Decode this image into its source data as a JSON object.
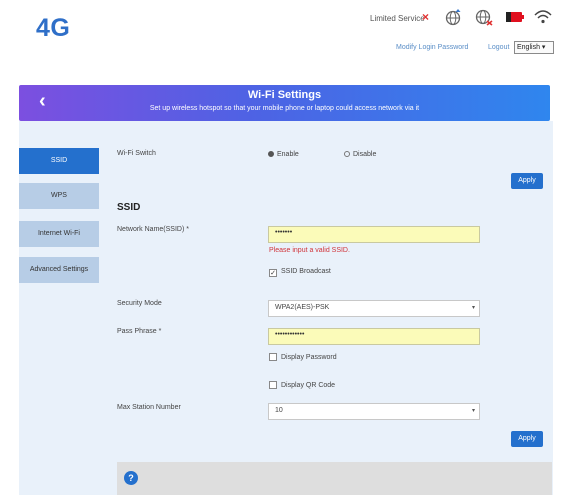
{
  "header": {
    "logo": "4G",
    "status_text": "Limited Service",
    "status_mark": "×",
    "links": {
      "modify_password": "Modify Login Password",
      "logout": "Logout"
    },
    "language": "English ▾",
    "icons": [
      "globe-icon",
      "no-signal-icon",
      "battery-icon",
      "wifi-icon"
    ],
    "colors": {
      "logo": "#2f6fc8",
      "battery": "#e0101f"
    }
  },
  "banner": {
    "back": "‹",
    "title": "Wi-Fi Settings",
    "subtitle": "Set up wireless hotspot so that your mobile phone or laptop could access network via it"
  },
  "sidebar": {
    "items": [
      {
        "label": "SSID"
      },
      {
        "label": "WPS"
      },
      {
        "label": "Internet Wi-Fi"
      },
      {
        "label": "Advanced Settings"
      }
    ]
  },
  "form": {
    "wifi_switch_label": "Wi-Fi Switch",
    "enable_label": "Enable",
    "disable_label": "Disable",
    "apply_label": "Apply",
    "ssid_heading": "SSID",
    "network_name_label": "Network Name(SSID) *",
    "network_name_value": "•••••••",
    "ssid_error": "Please input a valid SSID.",
    "ssid_broadcast_label": "SSID Broadcast",
    "security_mode_label": "Security Mode",
    "security_mode_value": "WPA2(AES)-PSK",
    "pass_phrase_label": "Pass Phrase *",
    "pass_phrase_value": "••••••••••••",
    "display_password_label": "Display Password",
    "display_qr_label": "Display QR Code",
    "max_station_label": "Max Station Number",
    "max_station_value": "10"
  },
  "help": {
    "icon": "?"
  },
  "colors": {
    "accent": "#2470cd",
    "sidebar_inactive": "#b7cde6",
    "input_highlight": "#fbfbb9",
    "error": "#d0343a"
  }
}
